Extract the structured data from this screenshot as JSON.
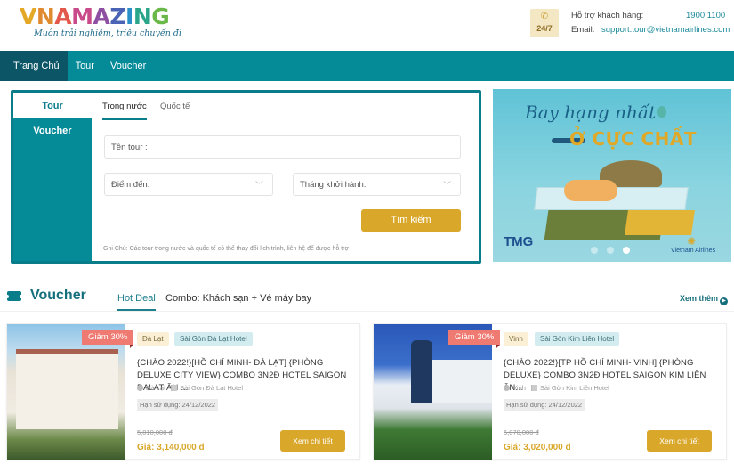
{
  "header": {
    "logo_letters": [
      {
        "ch": "V",
        "color": "#e3a826"
      },
      {
        "ch": "N",
        "color": "#e08a30"
      },
      {
        "ch": "A",
        "color": "#e2584b"
      },
      {
        "ch": "M",
        "color": "#c84a8a"
      },
      {
        "ch": "A",
        "color": "#8e4fa2"
      },
      {
        "ch": "Z",
        "color": "#4a63b5"
      },
      {
        "ch": "I",
        "color": "#2a8fc7"
      },
      {
        "ch": "N",
        "color": "#2aa58a"
      },
      {
        "ch": "G",
        "color": "#6bb84a"
      }
    ],
    "tagline": "Muôn trải nghiệm, triệu chuyến đi",
    "support_badge": {
      "icon": "phone-icon",
      "hours": "24/7"
    },
    "support_label": "Hỗ trợ khách hàng:",
    "support_phone": "1900.1100",
    "email_label": "Email:",
    "email_value": "support.tour@vietnamairlines.com"
  },
  "nav": {
    "items": [
      {
        "label": "Trang Chủ",
        "active": true
      },
      {
        "label": "Tour",
        "active": false
      },
      {
        "label": "Voucher",
        "active": false
      }
    ]
  },
  "search": {
    "side_tabs": [
      {
        "label": "Tour",
        "active": true
      },
      {
        "label": "Voucher",
        "active": false
      }
    ],
    "sub_tabs": [
      {
        "label": "Trong nước",
        "active": true
      },
      {
        "label": "Quốc tế",
        "active": false
      }
    ],
    "tour_name_placeholder": "Tên tour :",
    "destination_placeholder": "Điểm đến:",
    "month_placeholder": "Tháng khởi hành:",
    "search_button": "Tìm kiếm",
    "note": "Ghi Chú: Các tour trong nước và quốc tế có thể thay đổi lịch trình, liên hệ để được hỗ trợ"
  },
  "banner": {
    "line1": "Bay hạng nhất",
    "line2": "Ở CỰC CHẤT",
    "partner_left": "TMG",
    "partner_right": "Vietnam Airlines",
    "slides_total": 3,
    "active_slide": 3
  },
  "voucher_section": {
    "title": "Voucher",
    "tabs": [
      {
        "label": "Hot Deal",
        "active": true
      },
      {
        "label": "Combo: Khách sạn + Vé máy bay",
        "active": false
      }
    ],
    "see_more": "Xem thêm",
    "cards": [
      {
        "discount": "Giảm 30%",
        "location_tag": "Đà Lạt",
        "hotel_tag": "Sài Gòn Đà Lạt Hotel",
        "title": "{CHÀO 2022!}[HỒ CHÍ MINH- ĐÀ LẠT] {PHÒNG DELUXE CITY VIEW} COMBO 3N2Đ HOTEL SAIGON DALAT ĂN ...",
        "location": "Đà Lạt",
        "hotel": "Sài Gòn Đà Lạt Hotel",
        "expiry": "Hạn sử dụng: 24/12/2022",
        "old_price": "5,010,000 đ",
        "price": "Giá: 3,140,000 đ",
        "button": "Xem chi tiết"
      },
      {
        "discount": "Giảm 30%",
        "location_tag": "Vinh",
        "hotel_tag": "Sài Gòn Kim Liên Hotel",
        "title": "{CHÀO 2022!}[TP HỒ CHÍ MINH- VINH] {PHÒNG DELUXE} COMBO 3N2Đ HOTEL SAIGON KIM LIÊN ĂN...",
        "location": "Vinh",
        "hotel": "Sài Gòn Kim Liên Hotel",
        "expiry": "Hạn sử dụng: 24/12/2022",
        "old_price": "5,070,000 đ",
        "price": "Giá: 3,020,000 đ",
        "button": "Xem chi tiết"
      }
    ]
  }
}
